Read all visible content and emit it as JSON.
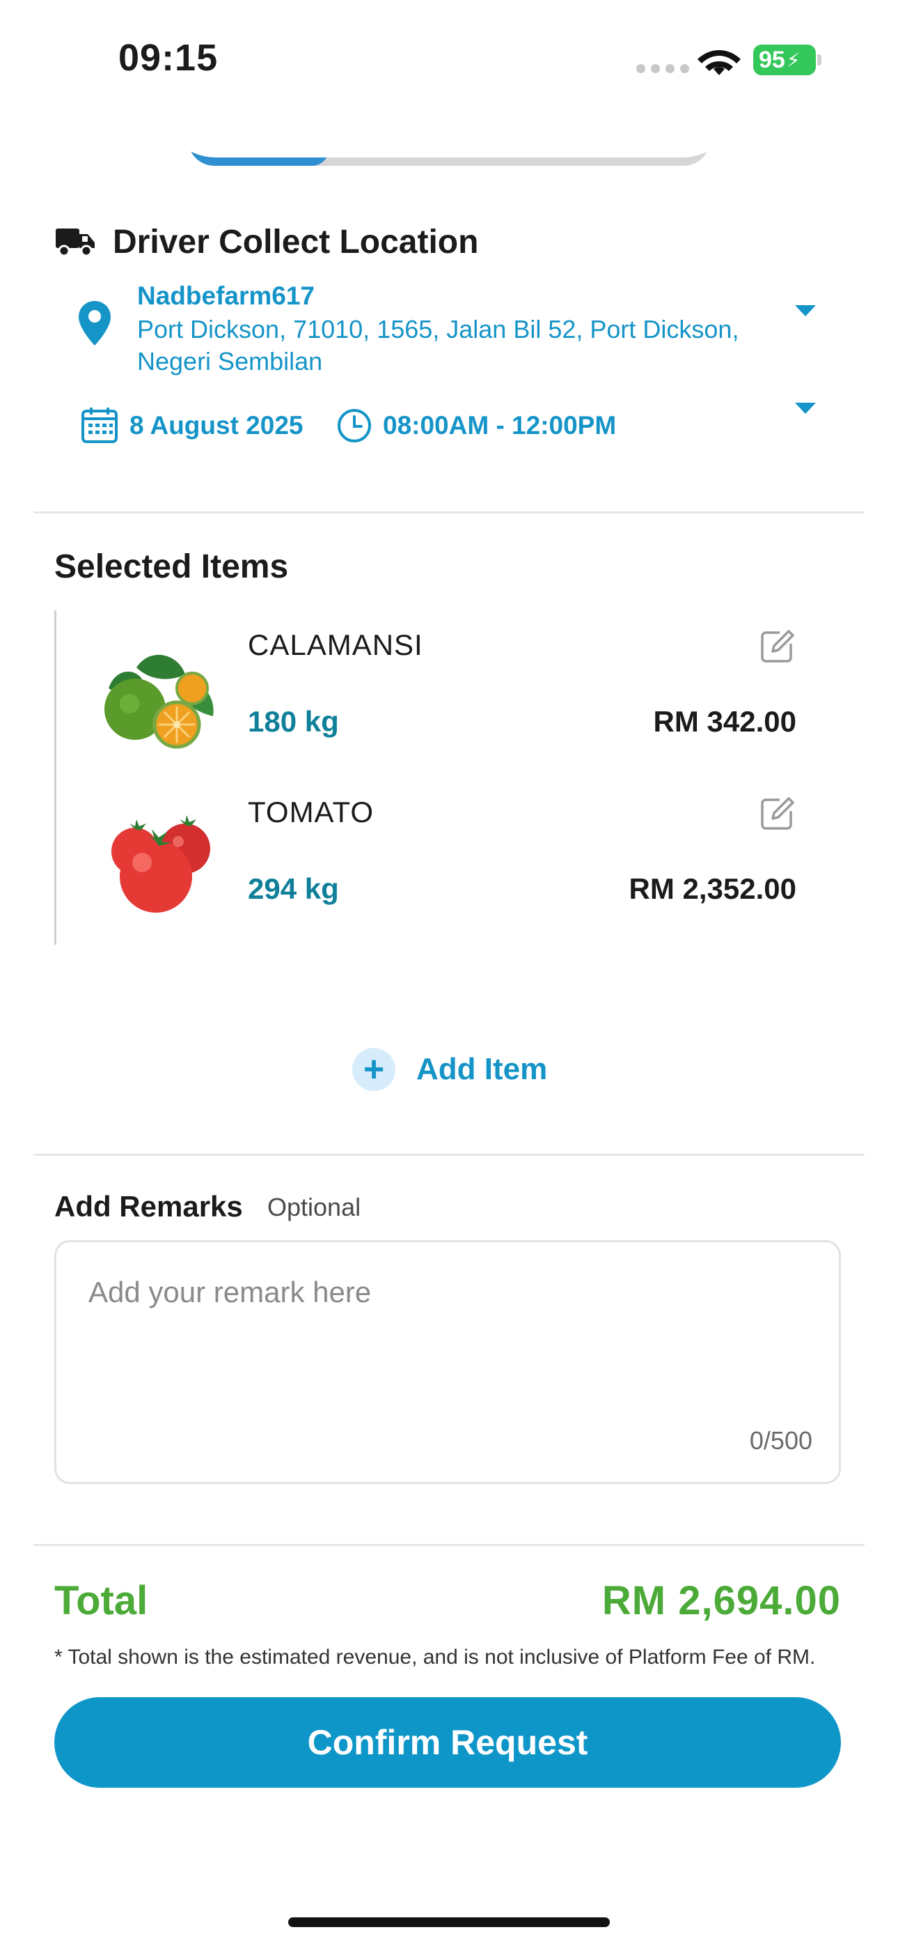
{
  "status_bar": {
    "time": "09:15",
    "battery": "95"
  },
  "progress": {
    "fraction": 0.27
  },
  "collect": {
    "title": "Driver Collect Location",
    "location_name": "Nadbefarm617",
    "address": "Port Dickson, 71010, 1565, Jalan Bil 52, Port Dickson, Negeri Sembilan",
    "date": "8 August 2025",
    "time_slot": "08:00AM - 12:00PM"
  },
  "items_section": {
    "title": "Selected Items",
    "items": [
      {
        "name": "CALAMANSI",
        "qty": "180 kg",
        "price": "RM 342.00",
        "image": "calamansi-image"
      },
      {
        "name": "TOMATO",
        "qty": "294 kg",
        "price": "RM 2,352.00",
        "image": "tomato-image"
      }
    ],
    "add_item_label": "Add Item"
  },
  "remarks": {
    "title": "Add Remarks",
    "optional_label": "Optional",
    "placeholder": "Add your remark here",
    "value": "",
    "count": "0/500"
  },
  "summary": {
    "total_label": "Total",
    "total_value": "RM 2,694.00",
    "note": "* Total shown is the estimated revenue, and is not inclusive of Platform Fee of RM."
  },
  "confirm_label": "Confirm Request",
  "colors": {
    "accent": "#1594c8",
    "total": "#4caa38",
    "qty": "#0f7f9a",
    "button": "#0f96c9"
  }
}
